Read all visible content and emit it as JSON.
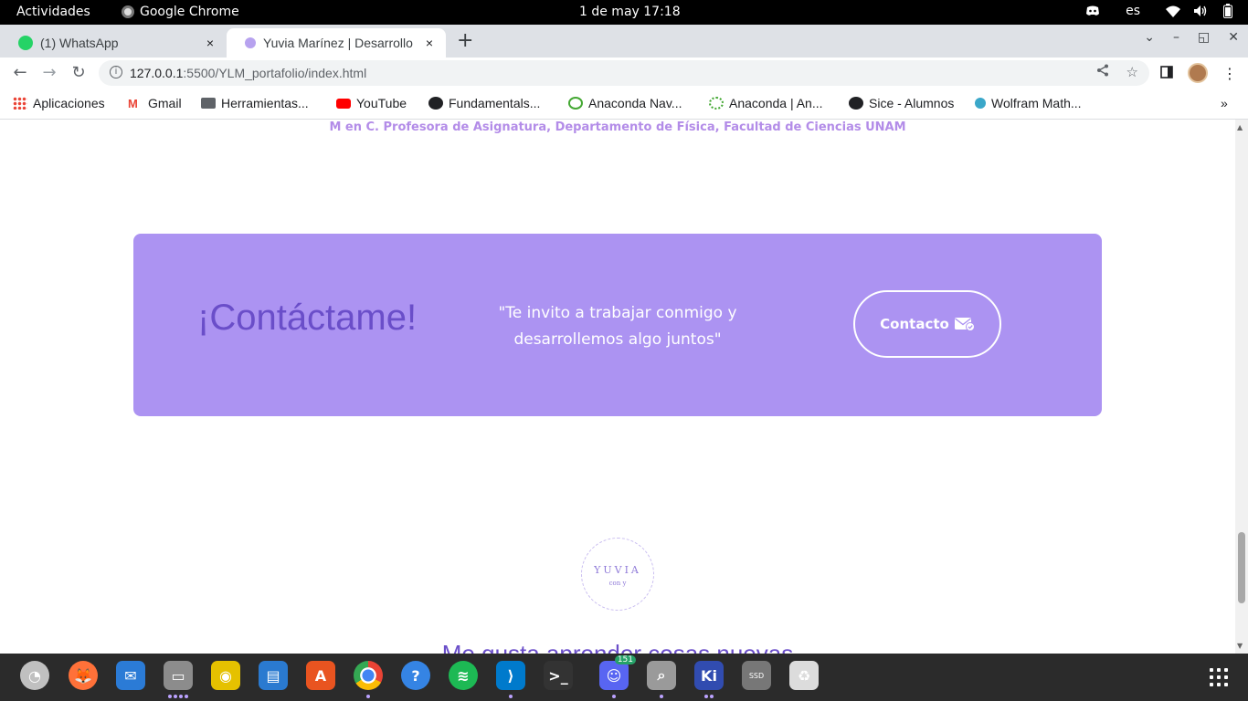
{
  "system": {
    "activities": "Actividades",
    "app_name": "Google Chrome",
    "clock": "1 de may  17:18",
    "lang": "es"
  },
  "tabs": [
    {
      "title": "(1) WhatsApp",
      "close": "×"
    },
    {
      "title": "Yuvia Marínez | Desarrollo",
      "close": "×"
    }
  ],
  "new_tab": "+",
  "window_controls": [
    "⌄",
    "–",
    "◱",
    "✕"
  ],
  "omnibox": {
    "host": "127.0.0.1",
    "path": ":5500/YLM_portafolio/index.html"
  },
  "bookmarks": [
    {
      "label": "Aplicaciones",
      "icon": "apps-grid-icon",
      "color": "#4285f4"
    },
    {
      "label": "Gmail",
      "icon": "gmail-icon",
      "color": "#ea4335"
    },
    {
      "label": "Herramientas...",
      "icon": "folder-icon",
      "color": "#5f6368"
    },
    {
      "label": "YouTube",
      "icon": "youtube-icon",
      "color": "#ff0000"
    },
    {
      "label": "Fundamentals...",
      "icon": "globe-icon",
      "color": "#202124"
    },
    {
      "label": "Anaconda Nav...",
      "icon": "anaconda-icon",
      "color": "#44a833"
    },
    {
      "label": "Anaconda | An...",
      "icon": "anaconda-ring-icon",
      "color": "#44a833"
    },
    {
      "label": "Sice - Alumnos",
      "icon": "globe-icon",
      "color": "#202124"
    },
    {
      "label": "Wolfram Math...",
      "icon": "wolfram-icon",
      "color": "#3aa7c9"
    }
  ],
  "bookmarks_more": "»",
  "page": {
    "subtitle": "M en C. Profesora de Asignatura, Departamento de Física, Facultad de Ciencias UNAM",
    "contact": {
      "heading": "¡Contáctame!",
      "quote": "\"Te invito a trabajar conmigo y desarrollemos algo juntos\"",
      "button": "Contacto"
    },
    "logo": {
      "word": "YUVIA",
      "sub": "con y"
    },
    "tagline": "Me gusta aprender cosas nuevas"
  },
  "dock": {
    "discord_badge": "151",
    "apps": [
      {
        "name": "app-launcher",
        "bg": "#c0c0c0",
        "glyph": "◔"
      },
      {
        "name": "firefox",
        "bg": "#ff7139",
        "glyph": "🦊"
      },
      {
        "name": "thunderbird",
        "bg": "#2b7bd6",
        "glyph": "✉"
      },
      {
        "name": "files",
        "bg": "#8c8c8c",
        "glyph": "▭"
      },
      {
        "name": "rhythmbox",
        "bg": "#e5c100",
        "glyph": "◉"
      },
      {
        "name": "writer",
        "bg": "#2a7ad0",
        "glyph": "▤"
      },
      {
        "name": "software",
        "bg": "#e95420",
        "glyph": "A"
      },
      {
        "name": "chrome",
        "bg": "#ffffff",
        "glyph": "◎"
      },
      {
        "name": "help",
        "bg": "#3584e4",
        "glyph": "?"
      },
      {
        "name": "spotify",
        "bg": "#1db954",
        "glyph": "≋"
      },
      {
        "name": "vscode",
        "bg": "#007acc",
        "glyph": "⟩"
      },
      {
        "name": "terminal",
        "bg": "#333333",
        "glyph": ">_"
      },
      {
        "name": "discord",
        "bg": "#5865f2",
        "glyph": "☺"
      },
      {
        "name": "image-viewer",
        "bg": "#9a9a9a",
        "glyph": "⌕"
      },
      {
        "name": "kicad",
        "bg": "#314cb0",
        "glyph": "Ki"
      },
      {
        "name": "ssd",
        "bg": "#777777",
        "glyph": "SSD"
      },
      {
        "name": "trash",
        "bg": "#dcdcdc",
        "glyph": "♻"
      }
    ]
  }
}
